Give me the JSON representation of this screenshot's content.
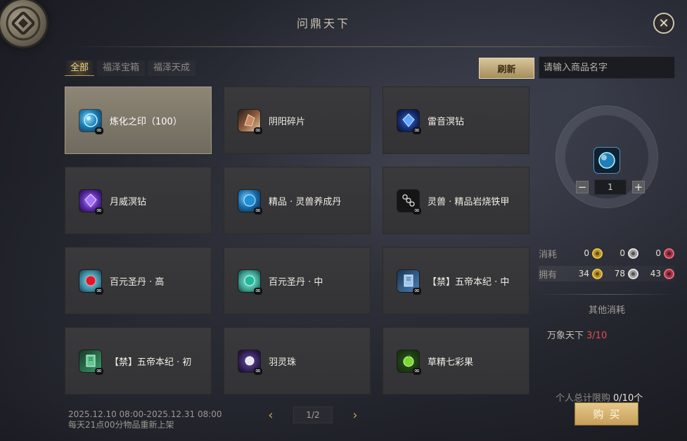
{
  "window": {
    "title": "问鼎天下",
    "close_symbol": "✕"
  },
  "tabs": [
    {
      "label": "全部",
      "active": true
    },
    {
      "label": "福泽宝箱",
      "active": false
    },
    {
      "label": "福泽天成",
      "active": false
    }
  ],
  "toolbar": {
    "refresh_label": "刷新",
    "search_placeholder": "请输入商品名字"
  },
  "items": [
    {
      "name": "炼化之印（100）",
      "icon": "blue-orb-icon",
      "badge": "∞",
      "selected": true
    },
    {
      "name": "阴阳碎片",
      "icon": "shard-icon",
      "badge": "∞"
    },
    {
      "name": "雷音溟钻",
      "icon": "blue-gem-icon",
      "badge": "∞"
    },
    {
      "name": "月威溟钻",
      "icon": "purple-gem-icon",
      "badge": "∞"
    },
    {
      "name": "精品 · 灵兽养成丹",
      "icon": "blue-pill-icon",
      "badge": "∞"
    },
    {
      "name": "灵兽 · 精品岩烧铁甲",
      "icon": "armor-chain-icon",
      "badge": "∞"
    },
    {
      "name": "百元圣丹 · 高",
      "icon": "red-pill-icon",
      "badge": "∞"
    },
    {
      "name": "百元圣丹 · 中",
      "icon": "green-pill-icon",
      "badge": "∞"
    },
    {
      "name": "【禁】五帝本纪 · 中",
      "icon": "blue-book-icon",
      "badge": "∞"
    },
    {
      "name": "【禁】五帝本纪 · 初",
      "icon": "green-book-icon",
      "badge": "∞"
    },
    {
      "name": "羽灵珠",
      "icon": "pearl-icon",
      "badge": "∞"
    },
    {
      "name": "草精七彩果",
      "icon": "green-fruit-icon",
      "badge": "∞"
    }
  ],
  "footer": {
    "date_range": "2025.12.10 08:00-2025.12.31 08:00",
    "restock_note": "每天21点00分物品重新上架",
    "page": "1/2",
    "prev_symbol": "‹",
    "next_symbol": "›"
  },
  "detail": {
    "quantity": "1",
    "minus": "−",
    "plus": "+",
    "cost_label": "消耗",
    "cost_values": [
      "0",
      "0",
      "0"
    ],
    "owned_label": "拥有",
    "owned_values": [
      "34",
      "78",
      "43"
    ],
    "currency_colors": [
      "#e8c24a",
      "#e2e2e2",
      "#e46a79"
    ],
    "other_cost_title": "其他消耗",
    "other_cost_name": "万象天下",
    "other_cost_count": "3/10",
    "limit_label": "个人总计限购",
    "limit_value": "0/10个",
    "buy_label": "购买"
  }
}
